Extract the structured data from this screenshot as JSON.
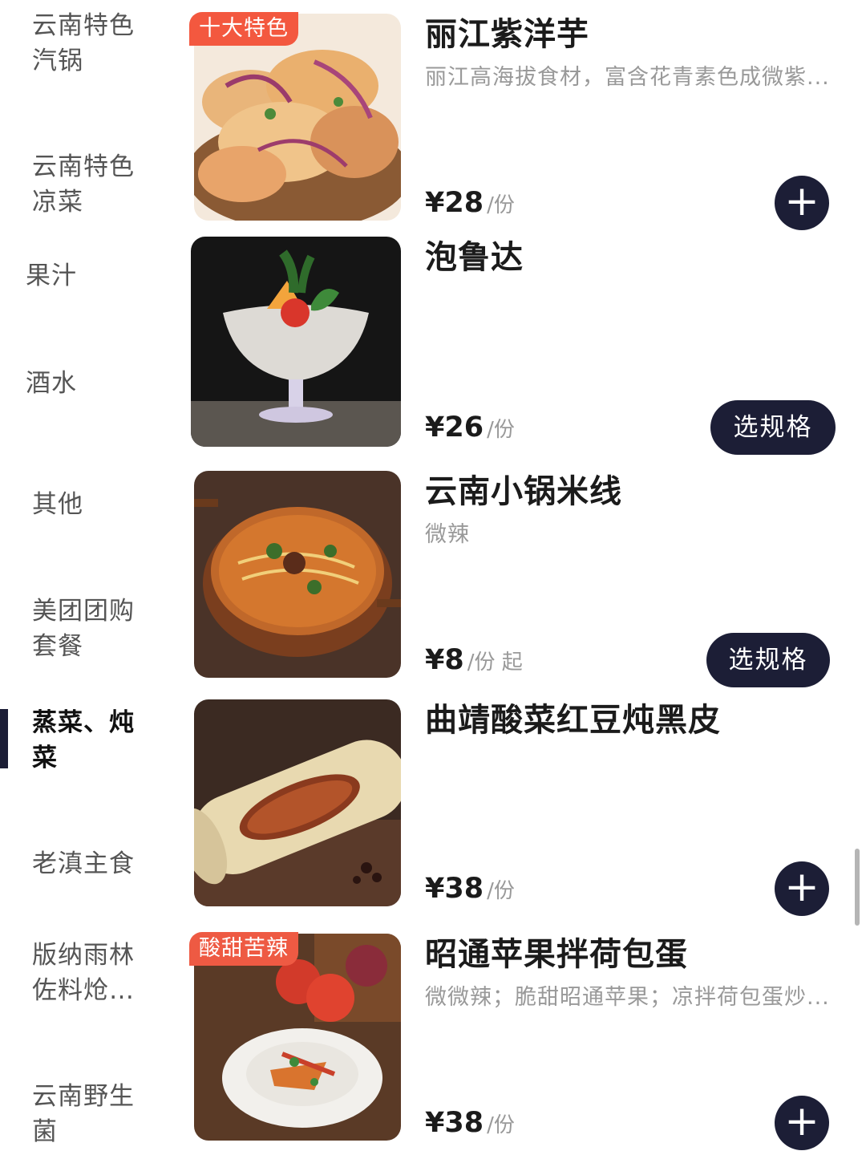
{
  "sidebar": {
    "categories": [
      {
        "label": "云南特色汽锅"
      },
      {
        "label": "云南特色凉菜"
      },
      {
        "label": "果汁"
      },
      {
        "label": "酒水"
      },
      {
        "label": "其他"
      },
      {
        "label": "美团团购套餐"
      },
      {
        "label": "蒸菜、炖菜",
        "active": true
      },
      {
        "label": "老滇主食"
      },
      {
        "label": "版纳雨林佐料炝…"
      },
      {
        "label": "云南野生菌"
      }
    ]
  },
  "items": [
    {
      "tag": "十大特色",
      "name": "丽江紫洋芋",
      "desc": "丽江高海拔食材，富含花青素色成微紫...",
      "price": "¥28",
      "unit": "/份",
      "action": "+",
      "image_icon": "purple-potato-chips-photo"
    },
    {
      "name": "泡鲁达",
      "price": "¥26",
      "unit": "/份",
      "action": "选规格",
      "image_icon": "paoluda-dessert-photo"
    },
    {
      "name": "云南小锅米线",
      "desc": "微辣",
      "price": "¥8",
      "unit": "/份 起",
      "action": "选规格",
      "image_icon": "rice-noodle-pot-photo"
    },
    {
      "name": "曲靖酸菜红豆炖黑皮",
      "price": "¥38",
      "unit": "/份",
      "action": "+",
      "image_icon": "bamboo-stew-photo"
    },
    {
      "tag": "酸甜苦辣",
      "name": "昭通苹果拌荷包蛋",
      "desc": "微微辣；脆甜昭通苹果；凉拌荷包蛋炒...",
      "price": "¥38",
      "unit": "/份",
      "action": "+",
      "image_icon": "apple-salad-photo"
    }
  ],
  "colors": {
    "accent_dark": "#1c1e36",
    "tag_red": "#f3583f",
    "muted_text": "#999999"
  }
}
